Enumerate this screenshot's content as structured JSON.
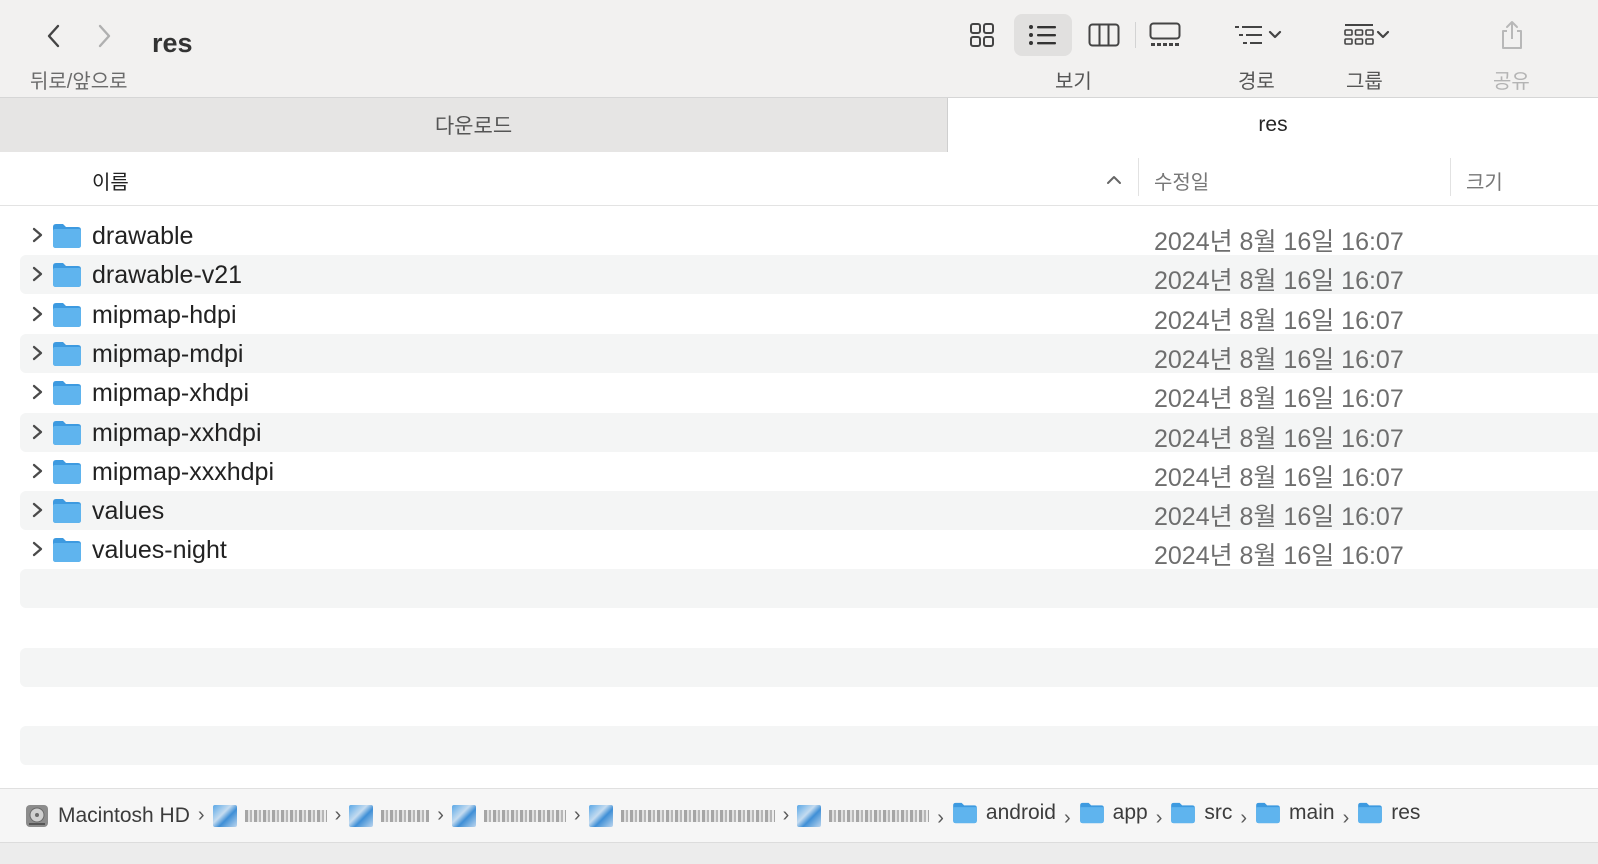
{
  "window": {
    "title": "res",
    "nav_caption": "뒤로/앞으로"
  },
  "toolbar": {
    "view_caption": "보기",
    "path_caption": "경로",
    "group_caption": "그룹",
    "share_caption": "공유",
    "views": [
      {
        "icon": "icon-grid-view-icon",
        "selected": false
      },
      {
        "icon": "list-view-icon",
        "selected": true
      },
      {
        "icon": "column-view-icon",
        "selected": false
      },
      {
        "icon": "gallery-view-icon",
        "selected": false
      }
    ]
  },
  "tabs": [
    {
      "label": "다운로드",
      "active": false
    },
    {
      "label": "res",
      "active": true
    }
  ],
  "columns": {
    "name": "이름",
    "modified": "수정일",
    "size": "크기"
  },
  "files": [
    {
      "name": "drawable",
      "modified": "2024년 8월 16일 16:07"
    },
    {
      "name": "drawable-v21",
      "modified": "2024년 8월 16일 16:07"
    },
    {
      "name": "mipmap-hdpi",
      "modified": "2024년 8월 16일 16:07"
    },
    {
      "name": "mipmap-mdpi",
      "modified": "2024년 8월 16일 16:07"
    },
    {
      "name": "mipmap-xhdpi",
      "modified": "2024년 8월 16일 16:07"
    },
    {
      "name": "mipmap-xxhdpi",
      "modified": "2024년 8월 16일 16:07"
    },
    {
      "name": "mipmap-xxxhdpi",
      "modified": "2024년 8월 16일 16:07"
    },
    {
      "name": "values",
      "modified": "2024년 8월 16일 16:07"
    },
    {
      "name": "values-night",
      "modified": "2024년 8월 16일 16:07"
    }
  ],
  "pathbar": {
    "root": "Macintosh HD",
    "segments": [
      "android",
      "app",
      "src",
      "main",
      "res"
    ]
  },
  "colors": {
    "folder": "#5fb4ee",
    "folder_dark": "#3d9ae0",
    "toolbar_bg": "#f2f1f0",
    "row_stripe": "#f4f5f5"
  }
}
